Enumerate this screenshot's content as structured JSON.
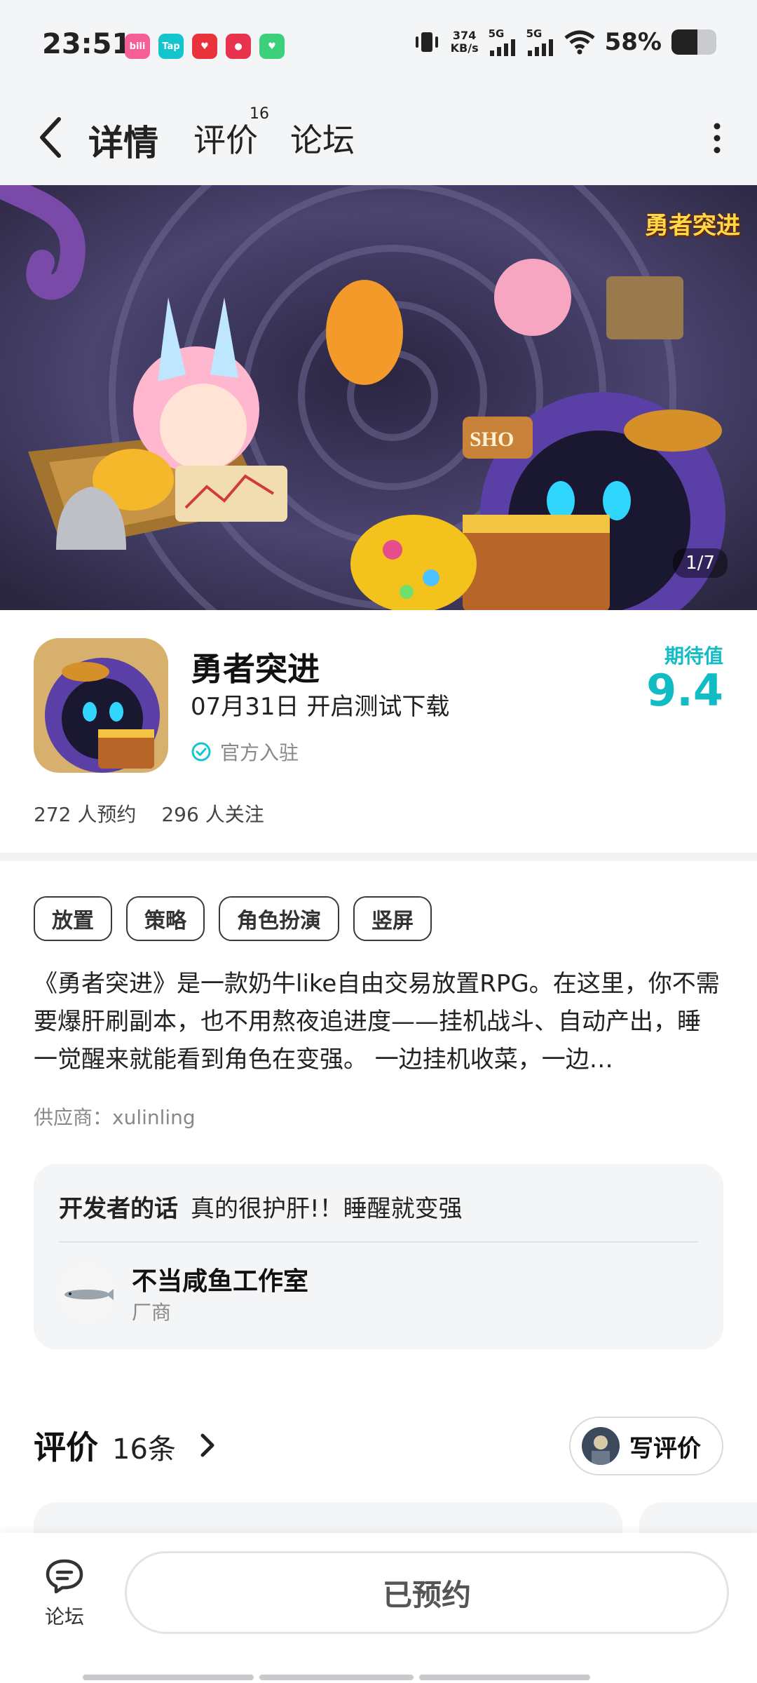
{
  "status_bar": {
    "time": "23:51",
    "app_icons": [
      {
        "name": "bilibili-icon",
        "text": "bili",
        "color": "#f55f95"
      },
      {
        "name": "taptap-icon",
        "text": "Tap",
        "color": "#15c5ce"
      },
      {
        "name": "heart-app-icon",
        "text": "♥",
        "color": "#e8323c"
      },
      {
        "name": "red-app-icon",
        "text": "●",
        "color": "#e9334e"
      },
      {
        "name": "green-app-icon",
        "text": "♥",
        "color": "#3dd07c"
      }
    ],
    "net_speed": "374",
    "net_unit": "KB/s",
    "sig1_label": "5G",
    "sig2_label": "5G",
    "battery_text": "58%",
    "battery_level": 0.58
  },
  "nav": {
    "tab_detail": "详情",
    "tab_review": "评价",
    "tab_review_badge": "16",
    "tab_forum": "论坛"
  },
  "banner": {
    "counter": "1/7",
    "logo_text": "勇者突进"
  },
  "game": {
    "title": "勇者突进",
    "date_text": "07月31日 开启测试下载",
    "official": "官方入驻",
    "expect_label": "期待值",
    "expect_value": "9.4",
    "reservations": "272 人预约",
    "followers": "296 人关注"
  },
  "tags": [
    "放置",
    "策略",
    "角色扮演",
    "竖屏"
  ],
  "description": "《勇者突进》是一款奶牛like自由交易放置RPG。在这里，你不需要爆肝刷副本，也不用熬夜追进度——挂机战斗、自动产出，睡一觉醒来就能看到角色在变强。 一边挂机收菜，一边…",
  "supplier": "供应商：xulinling",
  "developer": {
    "words_label": "开发者的话",
    "words": "真的很护肝!！睡醒就变强",
    "name": "不当咸鱼工作室",
    "role": "厂商"
  },
  "reviews": {
    "title": "评价",
    "count": "16条",
    "write_label": "写评价"
  },
  "bottom": {
    "forum_label": "论坛",
    "reserve_label": "已预约"
  },
  "colors": {
    "accent": "#15c5ce",
    "expect": "#12bcc5"
  }
}
